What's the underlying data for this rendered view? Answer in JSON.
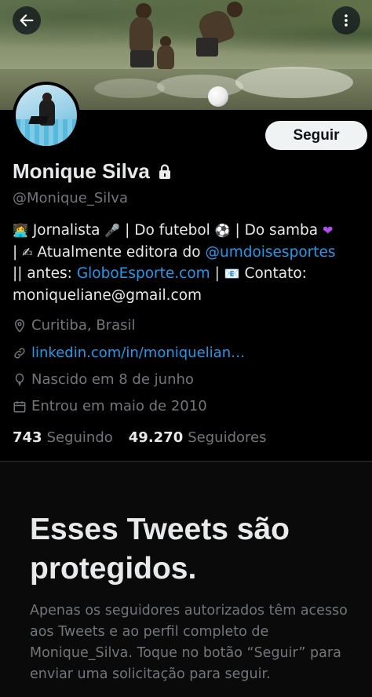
{
  "header": {
    "back_icon": "arrow-left-icon",
    "more_icon": "more-vertical-icon"
  },
  "profile": {
    "name": "Monique Silva",
    "handle": "@Monique_Silva",
    "follow_label": "Seguir",
    "bio": {
      "line1": "Jornalista",
      "line1b": "| Do futebol",
      "line1c": "| Do samba",
      "line2_prefix": "|",
      "line2_text": "Atualmente editora do",
      "line2_mention": "@umdoisesportes",
      "line3_prefix": "|| antes:",
      "line3_link": "GloboEsporte.com",
      "line3_sep": "|",
      "line3_text": "Contato:",
      "line4": "moniqueliane@gmail.com"
    },
    "location": "Curitiba, Brasil",
    "website": "linkedin.com/in/moniquelian…",
    "birthday": "Nascido em 8 de junho",
    "joined": "Entrou em maio de 2010",
    "following_count": "743",
    "following_label": "Seguindo",
    "followers_count": "49.270",
    "followers_label": "Seguidores"
  },
  "protected": {
    "title": "Esses Tweets são protegidos.",
    "text": "Apenas os seguidores autorizados têm acesso aos Tweets e ao perfil completo de Monique_Silva. Toque no botão “Seguir” para enviar uma solicitação para seguir."
  },
  "colors": {
    "accent": "#1d9bf0",
    "background": "#000000",
    "muted": "#71767b"
  }
}
